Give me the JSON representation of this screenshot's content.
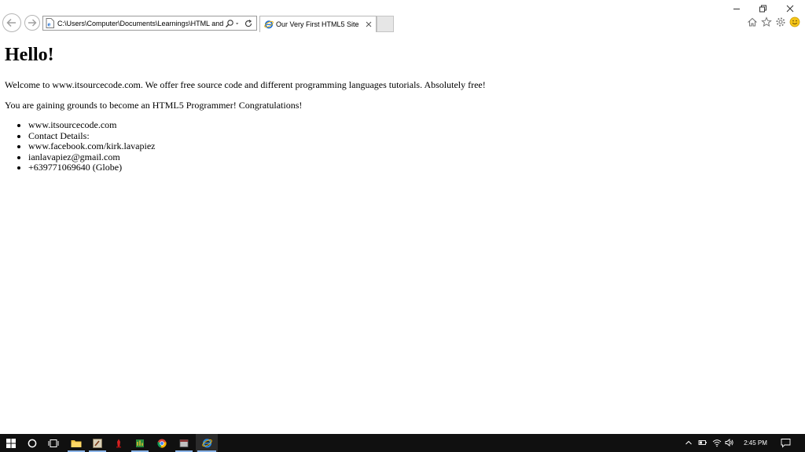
{
  "browser": {
    "address": "C:\\Users\\Computer\\Documents\\Learnings\\HTML and",
    "tab_title": "Our Very First HTML5 Site"
  },
  "page": {
    "heading": "Hello!",
    "paragraphs": [
      "Welcome to www.itsourcecode.com. We offer free source code and different programming languages tutorials. Absolutely free!",
      "You are gaining grounds to become an HTML5 Programmer! Congratulations!"
    ],
    "list_items": [
      "www.itsourcecode.com",
      "Contact Details:",
      "www.facebook.com/kirk.lavapiez",
      "ianlavapiez@gmail.com",
      "+639771069640 (Globe)"
    ]
  },
  "taskbar": {
    "clock": "2:45 PM"
  },
  "colors": {
    "taskbar": "#101010",
    "ie_blue": "#1e6fd6",
    "active_indicator": "#8ab4e8"
  }
}
